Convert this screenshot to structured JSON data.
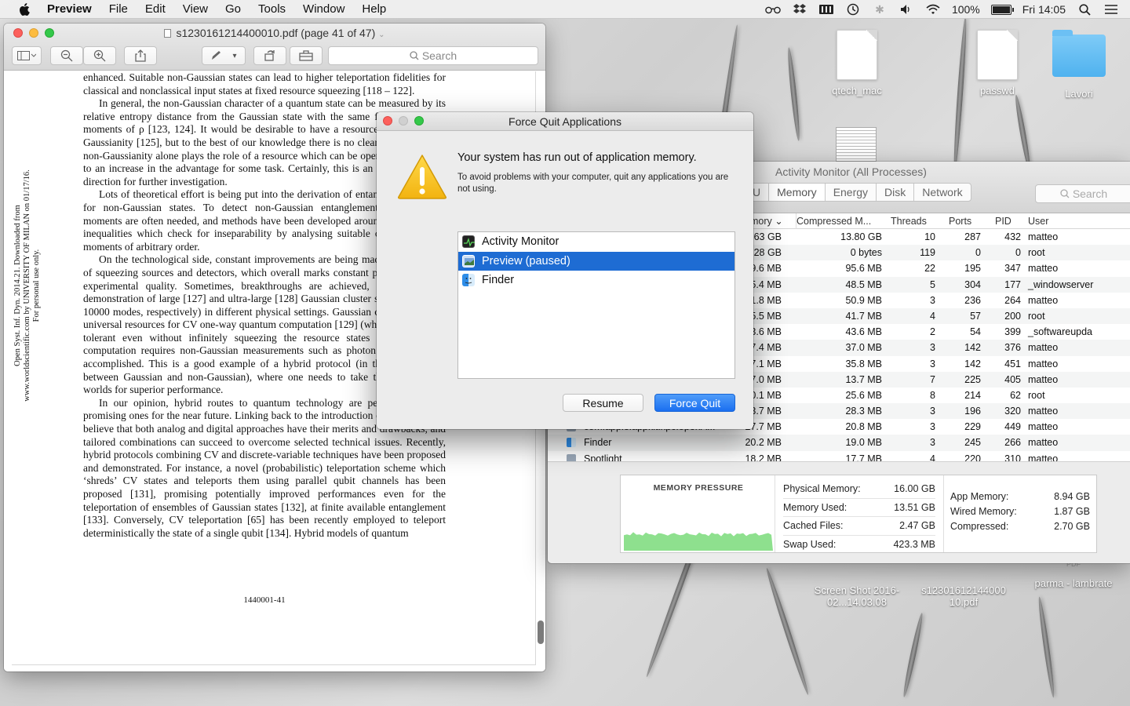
{
  "menubar": {
    "app_name": "Preview",
    "menus": [
      "File",
      "Edit",
      "View",
      "Go",
      "Tools",
      "Window",
      "Help"
    ],
    "battery": "100%",
    "clock": "Fri 14:05"
  },
  "desktop": {
    "icons": [
      {
        "label": "qtech_mac"
      },
      {
        "label": "passwd"
      },
      {
        "label": "Lavori"
      },
      {
        "label": "Screen Shot 2016-02...14.03.08"
      },
      {
        "label": "s12301612144000 10.pdf"
      },
      {
        "label": "parma - lambrate"
      }
    ],
    "pdf_badge": "PDF"
  },
  "preview": {
    "title": "s1230161214400010.pdf (page 41 of 47)",
    "search_placeholder": "Search",
    "sidenote": "Open Syst. Inf. Dyn. 2014.21. Downloaded from www.worldscientific.com by UNIVERSITY OF MILAN on 01/17/16. For personal use only.",
    "paragraphs": [
      "enhanced. Suitable non-Gaussian states can lead to higher teleportation fidelities for classical and nonclassical input states at fixed resource squeezing [118 – 122].",
      "In general, the non-Gaussian character of a quantum state can be measured by its relative entropy distance from the Gaussian state with the same first and second moments of ρ [123, 124]. It would be desirable to have a resource theory of non-Gaussianity [125], but to the best of our knowledge there is no clear protocol where non-Gaussianity alone plays the role of a resource which can be operationally linked to an increase in the advantage for some task. Certainly, this is an interesting open direction for further investigation.",
      "Lots of theoretical effort is being put into the derivation of entanglement criteria for non-Gaussian states. To detect non-Gaussian entanglement, higher order moments are often needed, and methods have been developed around hierarchies of inequalities which check for inseparability by analysing suitable combinations of moments of arbitrary order.",
      "On the technological side, constant improvements are being made to the quality of squeezing sources and detectors, which overall marks constant progresses in the experimental quality. Sometimes, breakthroughs are achieved, like the recent demonstration of large [127] and ultra-large [128] Gaussian cluster states (of 60 and 10000 modes, respectively) in different physical settings. Gaussian cluster states are universal resources for CV one-way quantum computation [129] (which can be fault-tolerant even without infinitely squeezing the resource states [130]), yet the computation requires non-Gaussian measurements such as photon counting to be accomplished. This is a good example of a hybrid protocol (in this case, hybrid between Gaussian and non-Gaussian), where one needs to take the best of both worlds for superior performance.",
      "In our opinion, hybrid routes to quantum technology are perhaps the most promising ones for the near future. Linking back to the introduction of this work, we believe that both analog and digital approaches have their merits and drawbacks, and tailored combinations can succeed to overcome selected technical issues. Recently, hybrid protocols combining CV and discrete-variable techniques have been proposed and demonstrated. For instance, a novel (probabilistic) teleportation scheme which ‘shreds’ CV states and teleports them using parallel qubit channels has been proposed [131], promising potentially improved performances even for the teleportation of ensembles of Gaussian states [132], at finite available entanglement [133]. Conversely, CV teleportation [65] has been recently employed to teleport deterministically the state of a single qubit [134]. Hybrid models of quantum"
    ],
    "page_number": "1440001-41"
  },
  "activity_monitor": {
    "title": "Activity Monitor (All Processes)",
    "tabs": [
      "U",
      "Memory",
      "Energy",
      "Disk",
      "Network"
    ],
    "search_placeholder": "Search",
    "columns": [
      "mory",
      "Compressed M...",
      "Threads",
      "Ports",
      "PID",
      "User"
    ],
    "rows": [
      {
        "name": "",
        "mem": "63 GB",
        "comp": "13.80 GB",
        "threads": "10",
        "ports": "287",
        "pid": "432",
        "user": "matteo"
      },
      {
        "name": "",
        "mem": "28 GB",
        "comp": "0 bytes",
        "threads": "119",
        "ports": "0",
        "pid": "0",
        "user": "root"
      },
      {
        "name": "",
        "mem": "9.6 MB",
        "comp": "95.6 MB",
        "threads": "22",
        "ports": "195",
        "pid": "347",
        "user": "matteo"
      },
      {
        "name": "",
        "mem": "5.4 MB",
        "comp": "48.5 MB",
        "threads": "5",
        "ports": "304",
        "pid": "177",
        "user": "_windowserver"
      },
      {
        "name": "",
        "mem": "1.8 MB",
        "comp": "50.9 MB",
        "threads": "3",
        "ports": "236",
        "pid": "264",
        "user": "matteo"
      },
      {
        "name": "",
        "mem": "5.5 MB",
        "comp": "41.7 MB",
        "threads": "4",
        "ports": "57",
        "pid": "200",
        "user": "root"
      },
      {
        "name": "",
        "mem": "3.6 MB",
        "comp": "43.6 MB",
        "threads": "2",
        "ports": "54",
        "pid": "399",
        "user": "_softwareupda"
      },
      {
        "name": "",
        "mem": "7.4 MB",
        "comp": "37.0 MB",
        "threads": "3",
        "ports": "142",
        "pid": "376",
        "user": "matteo"
      },
      {
        "name": "",
        "mem": "7.1 MB",
        "comp": "35.8 MB",
        "threads": "3",
        "ports": "142",
        "pid": "451",
        "user": "matteo"
      },
      {
        "name": "",
        "mem": "7.0 MB",
        "comp": "13.7 MB",
        "threads": "7",
        "ports": "225",
        "pid": "405",
        "user": "matteo"
      },
      {
        "name": "",
        "mem": "0.1 MB",
        "comp": "25.6 MB",
        "threads": "8",
        "ports": "214",
        "pid": "62",
        "user": "root"
      },
      {
        "name": "",
        "mem": "3.7 MB",
        "comp": "28.3 MB",
        "threads": "3",
        "ports": "196",
        "pid": "320",
        "user": "matteo"
      },
      {
        "name": "com.apple.appkit.xpc.openA...",
        "mem": "27.7 MB",
        "comp": "20.8 MB",
        "threads": "3",
        "ports": "229",
        "pid": "449",
        "user": "matteo"
      },
      {
        "name": "Finder",
        "mem": "20.2 MB",
        "comp": "19.0 MB",
        "threads": "3",
        "ports": "245",
        "pid": "266",
        "user": "matteo"
      },
      {
        "name": "Spotlight",
        "mem": "18.2 MB",
        "comp": "17.7 MB",
        "threads": "4",
        "ports": "220",
        "pid": "310",
        "user": "matteo"
      }
    ],
    "memory_pressure": {
      "title": "MEMORY PRESSURE",
      "stats": [
        {
          "label": "Physical Memory:",
          "value": "16.00 GB"
        },
        {
          "label": "Memory Used:",
          "value": "13.51 GB"
        },
        {
          "label": "Cached Files:",
          "value": "2.47 GB"
        },
        {
          "label": "Swap Used:",
          "value": "423.3 MB"
        }
      ],
      "stats2": [
        {
          "label": "App Memory:",
          "value": "8.94 GB"
        },
        {
          "label": "Wired Memory:",
          "value": "1.87 GB"
        },
        {
          "label": "Compressed:",
          "value": "2.70 GB"
        }
      ],
      "graph_color": "#8ee08e"
    }
  },
  "force_quit": {
    "title": "Force Quit Applications",
    "headline": "Your system has run out of application memory.",
    "message": "To avoid problems with your computer, quit any applications you are not using.",
    "apps": [
      {
        "name": "Activity Monitor",
        "selected": false
      },
      {
        "name": "Preview (paused)",
        "selected": true
      },
      {
        "name": "Finder",
        "selected": false
      }
    ],
    "resume_label": "Resume",
    "force_quit_label": "Force Quit",
    "accent": "#1e6cd3"
  }
}
